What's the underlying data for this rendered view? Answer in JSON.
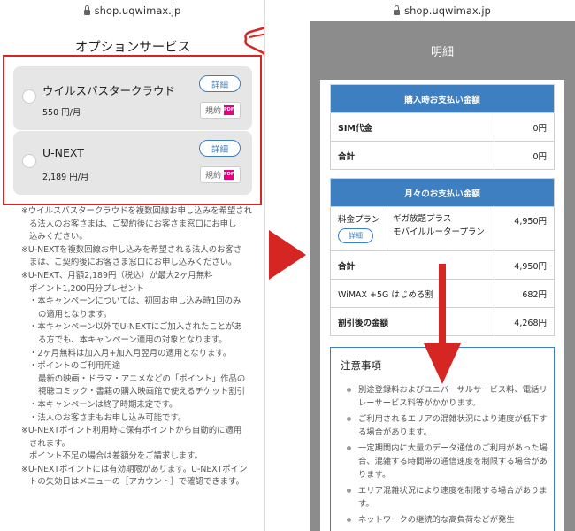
{
  "left": {
    "url": "shop.uqwimax.jp",
    "section_title": "オプションサービス",
    "options": [
      {
        "name": "ウイルスバスタークラウド",
        "price": "550 円/月",
        "detail_label": "詳細",
        "terms_label": "規約",
        "pdf_label": "PDF"
      },
      {
        "name": "U-NEXT",
        "price": "2,189 円/月",
        "detail_label": "詳細",
        "terms_label": "規約",
        "pdf_label": "PDF"
      }
    ],
    "notes": [
      "※ウイルスバスタークラウドを複数回線お申し込みを希望され",
      "る法人のお客さまは、ご契約後にお客さま窓口にお申し",
      "込みください。",
      "※U-NEXTを複数回線お申し込みを希望される法人のお客さ",
      "まは、ご契約後にお客さま窓口にお申し込みください。",
      "※U-NEXT、月額2,189円（税込）が最大2ヶ月無料",
      "ポイント1,200円分プレゼント",
      "・本キャンペーンについては、初回お申し込み時1回のみ",
      "の適用となります。",
      "・本キャンペーン以外でU-NEXTにご加入されたことがあ",
      "る方でも、本キャンペーン適用の対象となります。",
      "・2ヶ月無料は加入月+加入月翌月の適用となります。",
      "・ポイントのご利用用途",
      "最新の映画・ドラマ・アニメなどの「ポイント」作品の",
      "視聴コミック・書籍の購入映画館で使えるチケット割引",
      "・本キャンペーンは終了時期未定です。",
      "・法人のお客さまもお申し込み可能です。",
      "※U-NEXTポイント利用時に保有ポイントから自動的に適用",
      "されます。",
      "ポイント不足の場合は差額分をご請求します。",
      "※U-NEXTポイントには有効期限があります。U-NEXTポイン",
      "トの失効日はメニューの［アカウント］で確認できます。"
    ]
  },
  "right": {
    "url": "shop.uqwimax.jp",
    "modal_title": "明細",
    "purchase_table": {
      "header": "購入時お支払い金額",
      "rows": [
        {
          "label": "SIM代金",
          "value": "0円"
        },
        {
          "label": "合計",
          "value": "0円"
        }
      ]
    },
    "monthly_table": {
      "header": "月々のお支払い金額",
      "plan_label": "料金プラン",
      "plan_detail_label": "詳細",
      "plan_name_1": "ギガ放題プラス",
      "plan_name_2": "モバイルルータープラン",
      "plan_price": "4,950円",
      "rows": [
        {
          "label": "合計",
          "value": "4,950円"
        },
        {
          "label": "WiMAX +5G はじめる割",
          "value": "682円"
        },
        {
          "label": "割引後の金額",
          "value": "4,268円"
        }
      ]
    },
    "caution": {
      "title": "注意事項",
      "items": [
        "別途登録料およびユニバーサルサービス料、電話リレーサービス料等がかかります。",
        "ご利用されるエリアの混雑状況により速度が低下する場合があります。",
        "一定期間内に大量のデータ通信のご利用があった場合、混雑する時間帯の通信速度を制限する場合があります。",
        "エリア混雑状況により速度を制限する場合があります。",
        "ネットワークの継続的な高負荷などが発生"
      ]
    }
  },
  "colors": {
    "highlight": "#d62623",
    "accent_blue": "#3e7fc1",
    "modal_grey": "#8c8c8c"
  }
}
